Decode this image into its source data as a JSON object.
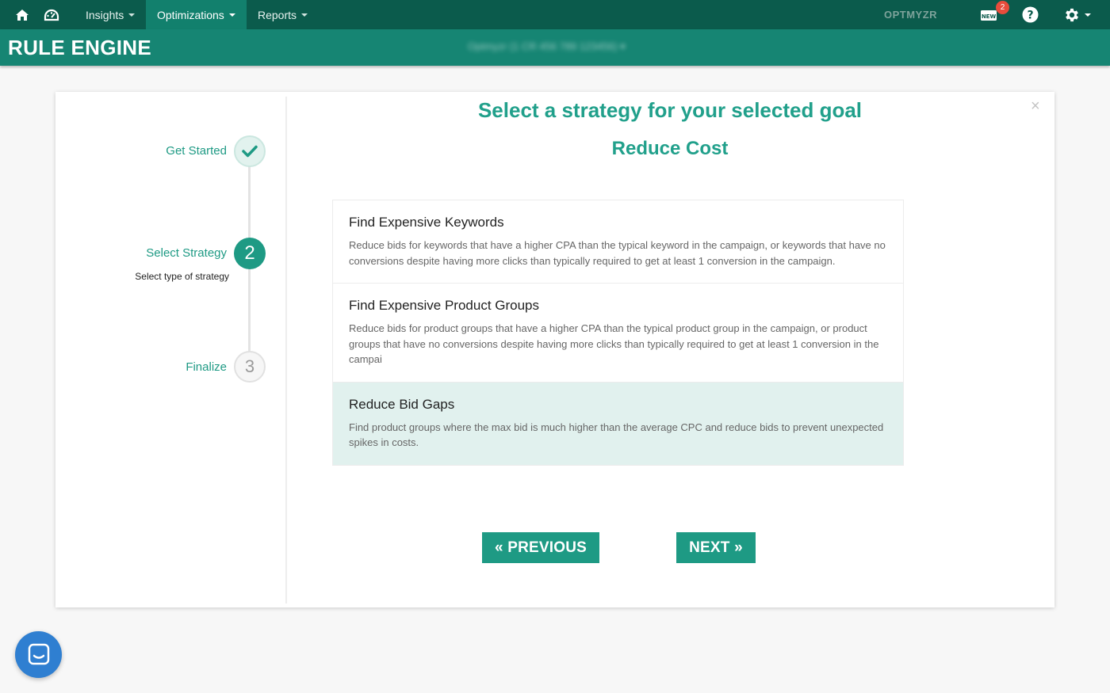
{
  "topnav": {
    "menus": [
      {
        "label": "Insights",
        "active": false
      },
      {
        "label": "Optimizations",
        "active": true
      },
      {
        "label": "Reports",
        "active": false
      }
    ],
    "brand": "OPTMYZR",
    "notification_count": "2",
    "new_label": "NEW"
  },
  "titlebar": {
    "title": "RULE ENGINE",
    "account": "Optmyzr (1 CR 456 789 123456) ▾"
  },
  "steps": [
    {
      "label": "Get Started",
      "status": "done"
    },
    {
      "label": "Select Strategy",
      "number": "2",
      "sub": "Select type of strategy",
      "status": "current"
    },
    {
      "label": "Finalize",
      "number": "3",
      "status": "future"
    }
  ],
  "main": {
    "heading": "Select a strategy for your selected goal",
    "goal": "Reduce Cost",
    "options": [
      {
        "title": "Find Expensive Keywords",
        "description": "Reduce bids for keywords that have a higher CPA than the typical keyword in the campaign, or keywords that have no conversions despite having more clicks than typically required to get at least 1 conversion in the campaign.",
        "selected": false
      },
      {
        "title": "Find Expensive Product Groups",
        "description": "Reduce bids for product groups that have a higher CPA than the typical product group in the campaign, or product groups that have no conversions despite having more clicks than typically required to get at least 1 conversion in the campai",
        "selected": false
      },
      {
        "title": "Reduce Bid Gaps",
        "description": "Find product groups where the max bid is much higher than the average CPC and reduce bids to prevent unexpected spikes in costs.",
        "selected": true
      }
    ],
    "prev_label": "« PREVIOUS",
    "next_label": "NEXT »",
    "close_label": "×"
  },
  "colors": {
    "topnav_bg": "#0b5b4c",
    "titlebar_bg": "#168573",
    "accent": "#1e9a84",
    "selected_bg": "#e1f1ee",
    "chat_bg": "#2f7fd1"
  },
  "icons": [
    "home-icon",
    "dashboard-icon",
    "new-icon",
    "help-icon",
    "gear-icon",
    "check-icon",
    "chat-icon"
  ]
}
